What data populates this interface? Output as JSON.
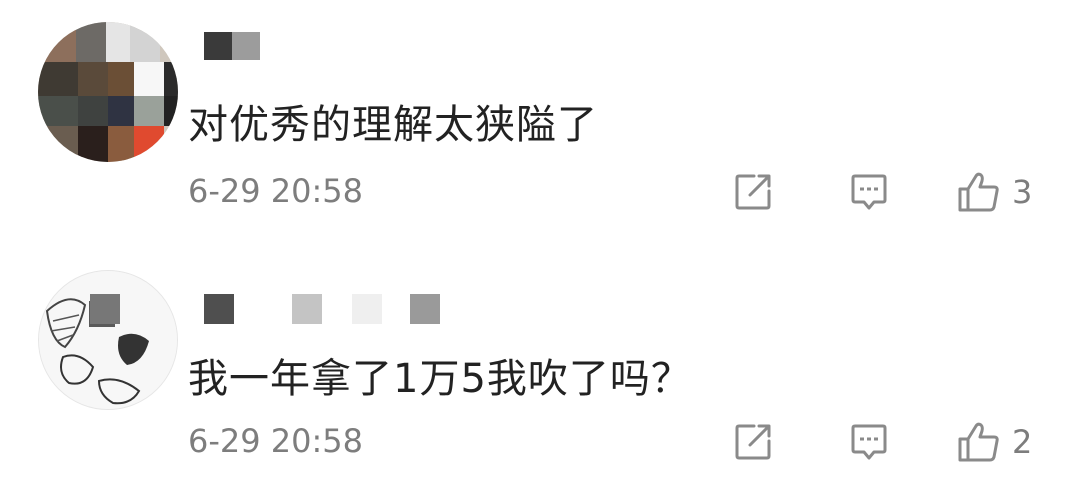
{
  "comments": [
    {
      "text": "对优秀的理解太狭隘了",
      "timestamp": "6-29 20:58",
      "likes": "3",
      "share_icon": "share-icon",
      "reply_icon": "reply-icon",
      "like_icon": "thumbs-up-icon"
    },
    {
      "text": "我一年拿了1万5我吹了吗？",
      "timestamp": "6-29 20:58",
      "likes": "2",
      "share_icon": "share-icon",
      "reply_icon": "reply-icon",
      "like_icon": "thumbs-up-icon"
    }
  ],
  "colors": {
    "text": "#222222",
    "meta": "#7d7d7d",
    "icon": "#8a8a8a",
    "background": "#ffffff"
  }
}
